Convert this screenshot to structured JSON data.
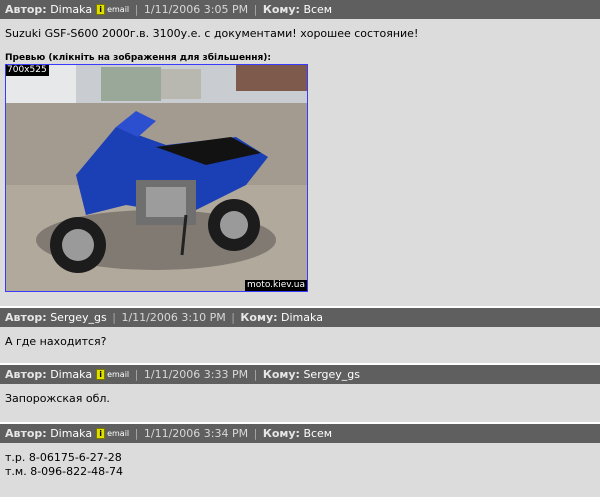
{
  "labels": {
    "author": "Автор:",
    "to": "Кому:",
    "email": "email",
    "info": "i"
  },
  "posts": [
    {
      "author": "Dimaka",
      "has_email": true,
      "date": "1/11/2006 3:05 PM",
      "to": "Всем",
      "lines": [
        "Suzuki GSF-S600 2000г.в. 3100у.е. с документами! хорошее состояние!"
      ],
      "preview": {
        "label": "Превью (клікніть на зображення для збільшення):",
        "dimensions": "700x525",
        "watermark": "moto.kiev.ua"
      }
    },
    {
      "author": "Sergey_gs",
      "has_email": false,
      "date": "1/11/2006 3:10 PM",
      "to": "Dimaka",
      "lines": [
        "А где находится?"
      ]
    },
    {
      "author": "Dimaka",
      "has_email": true,
      "date": "1/11/2006 3:33 PM",
      "to": "Sergey_gs",
      "lines": [
        "Запорожская обл."
      ]
    },
    {
      "author": "Dimaka",
      "has_email": true,
      "date": "1/11/2006 3:34 PM",
      "to": "Всем",
      "lines": [
        "т.р. 8-06175-6-27-28",
        "т.м. 8-096-822-48-74"
      ]
    }
  ],
  "colors": {
    "header_bg": "#5f5f5f",
    "body_bg": "#dcdcdc",
    "preview_border": "#3a3aff",
    "bike": "#1b3fb5"
  }
}
